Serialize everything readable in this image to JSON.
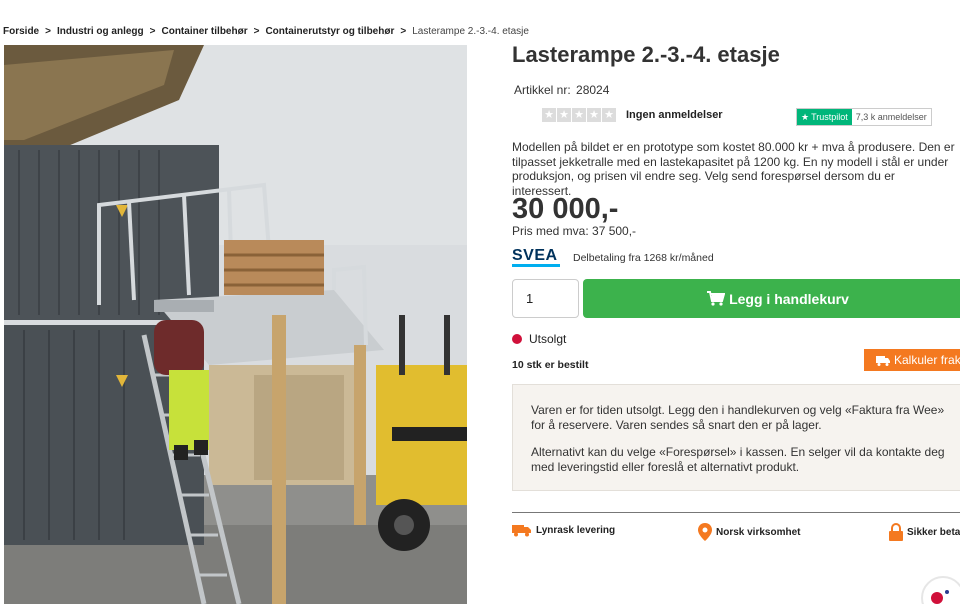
{
  "breadcrumb": {
    "items": [
      "Forside",
      "Industri og anlegg",
      "Container tilbehør",
      "Containerutstyr og tilbehør"
    ],
    "separator": ">",
    "current": "Lasterampe 2.-3.-4. etasje"
  },
  "product": {
    "title": "Lasterampe 2.-3.-4. etasje",
    "article_label": "Artikkel nr:",
    "article_number": "28024",
    "reviews_label": "Ingen anmeldelser",
    "star_count": 5,
    "description": "Modellen på bildet er en prototype som kostet 80.000 kr + mva å produsere. Den er tilpasset jekketralle med en lastekapasitet på 1200 kg. En ny modell i stål er under produksjon, og prisen vil endre seg. Velg send forespørsel dersom du er interessert.",
    "price": "30 000,-",
    "price_vat": "Pris med mva: 37 500,-"
  },
  "trustpilot": {
    "brand": "Trustpilot",
    "count": "7,3 k anmeldelser",
    "color": "#00b67a"
  },
  "financing": {
    "provider_logo": "SVEA",
    "text": "Delbetaling fra 1268 kr/måned"
  },
  "cart": {
    "quantity": "1",
    "add_label": "Legg i handlekurv",
    "button_color": "#3cb24c",
    "icon": "cart-icon"
  },
  "stock": {
    "status": "Utsolgt",
    "status_color": "#d0103a",
    "ordered": "10 stk er bestilt",
    "calc_label": "Kalkuler frakt",
    "calc_color": "#f47920"
  },
  "notice": {
    "paragraph1": "Varen er for tiden utsolgt. Legg den i handlekurven og velg «Faktura fra Wee» for å reservere. Varen sendes så snart den er på lager.",
    "paragraph2": "Alternativt kan du velge «Forespørsel» i kassen. En selger vil da kontakte deg med leveringstid eller foreslå et alternativt produkt."
  },
  "usps": [
    {
      "label": "Lynrask levering",
      "icon": "truck-icon"
    },
    {
      "label": "Norsk virksomhet",
      "icon": "location-pin-icon"
    },
    {
      "label": "Sikker betaling",
      "icon": "lock-icon"
    }
  ],
  "accent_color": "#f47920"
}
